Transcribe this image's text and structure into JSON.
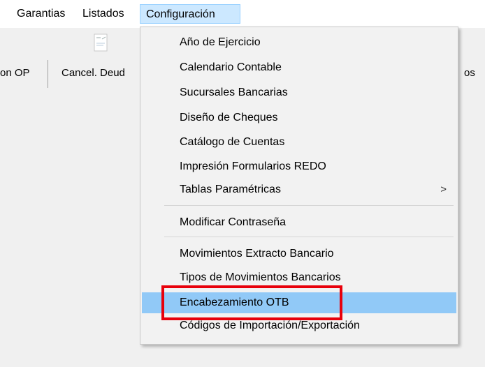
{
  "menubar": {
    "items": [
      {
        "label": "Garantias"
      },
      {
        "label": "Listados"
      },
      {
        "label": "Configuración"
      }
    ]
  },
  "toolbar": {
    "items": [
      {
        "label": "on OP"
      },
      {
        "label": "Cancel. Deud"
      },
      {
        "label": "os"
      }
    ],
    "icon": "document-icon"
  },
  "dropdown": {
    "items": [
      {
        "label": "Año de Ejercicio"
      },
      {
        "label": "Calendario Contable"
      },
      {
        "label": "Sucursales Bancarias"
      },
      {
        "label": "Diseño de Cheques"
      },
      {
        "label": "Catálogo de Cuentas"
      },
      {
        "label": "Impresión Formularios REDO"
      },
      {
        "label": "Tablas Paramétricas",
        "submenu_arrow": ">"
      },
      {
        "label": "Modificar Contraseña"
      },
      {
        "label": "Movimientos Extracto Bancario"
      },
      {
        "label": "Tipos de Movimientos Bancarios"
      },
      {
        "label": "Encabezamiento OTB"
      },
      {
        "label": "Códigos de Importación/Exportación"
      }
    ]
  },
  "colors": {
    "highlight": "#91c9f7",
    "annotation_box": "#e8000b",
    "active_menu": "#cce8ff"
  }
}
